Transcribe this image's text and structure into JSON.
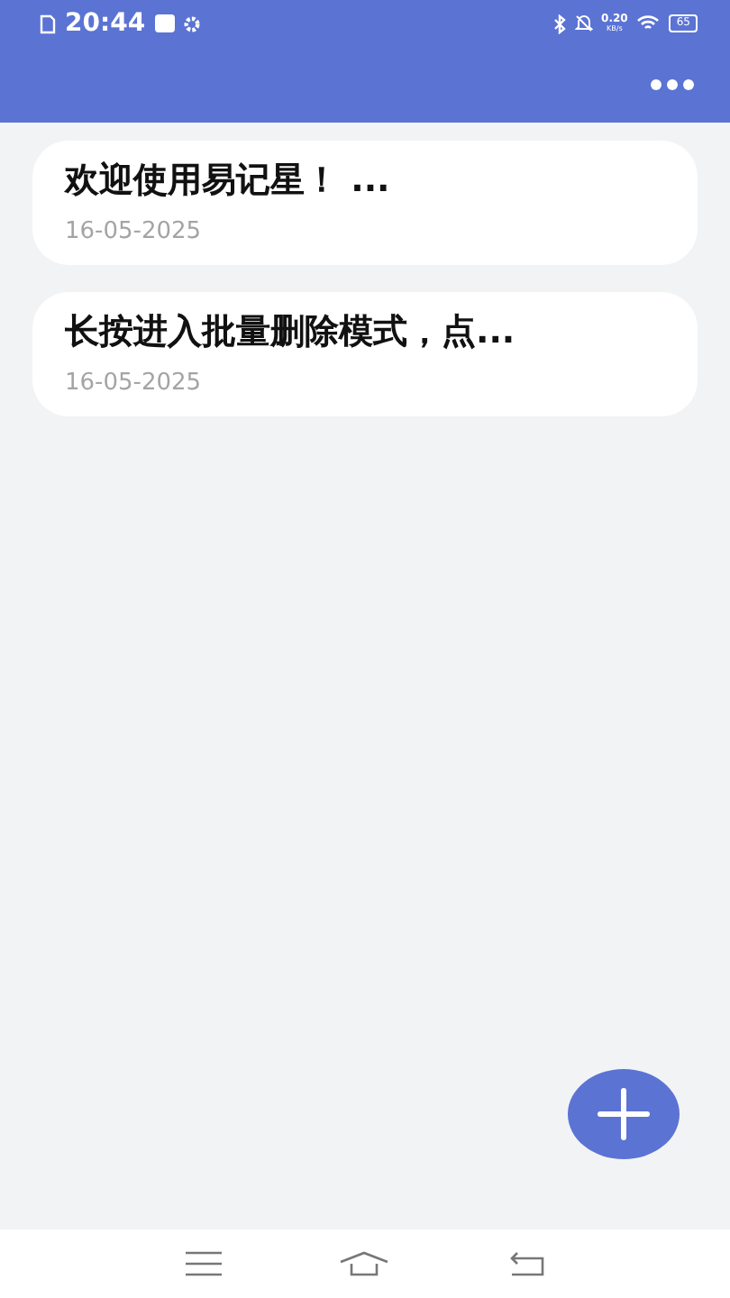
{
  "status_bar": {
    "time": "20:44",
    "speed_value": "0.20",
    "speed_unit": "KB/s",
    "battery": "65"
  },
  "notes": [
    {
      "title": "欢迎使用易记星！ ...",
      "date": "16-05-2025"
    },
    {
      "title": "长按进入批量删除模式，点...",
      "date": "16-05-2025"
    }
  ]
}
